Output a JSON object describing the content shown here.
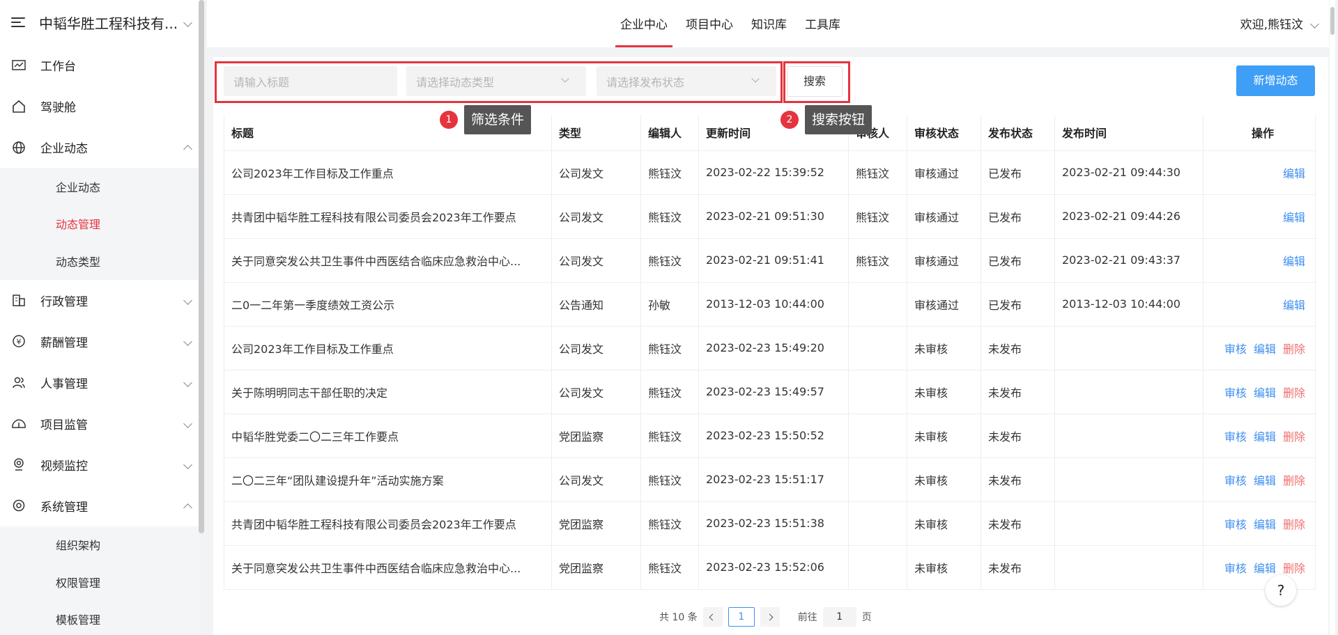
{
  "sidebar": {
    "brand": "中韬华胜工程科技有...",
    "items": [
      {
        "label": "工作台",
        "icon": "chart-line-icon"
      },
      {
        "label": "驾驶舱",
        "icon": "home-icon"
      },
      {
        "label": "企业动态",
        "icon": "globe-icon",
        "expanded": true
      },
      {
        "label": "行政管理",
        "icon": "building-icon"
      },
      {
        "label": "薪酬管理",
        "icon": "money-icon"
      },
      {
        "label": "人事管理",
        "icon": "users-icon"
      },
      {
        "label": "项目监管",
        "icon": "cloud-icon"
      },
      {
        "label": "视频监控",
        "icon": "location-icon"
      },
      {
        "label": "系统管理",
        "icon": "settings-icon",
        "expanded": true
      }
    ],
    "news_sub": [
      "企业动态",
      "动态管理",
      "动态类型"
    ],
    "system_sub": [
      "组织架构",
      "权限管理",
      "模板管理"
    ]
  },
  "topnav": {
    "tabs": [
      "企业中心",
      "项目中心",
      "知识库",
      "工具库"
    ],
    "active_tab": "企业中心",
    "user": "欢迎,熊钰汶"
  },
  "filters": {
    "title_placeholder": "请输入标题",
    "type_placeholder": "请选择动态类型",
    "status_placeholder": "请选择发布状态",
    "search_label": "搜索",
    "add_label": "新增动态"
  },
  "tips": {
    "filter_num": "1",
    "filter_text": "筛选条件",
    "search_num": "2",
    "search_text": "搜索按钮"
  },
  "table": {
    "headers": [
      "标题",
      "类型",
      "编辑人",
      "更新时间",
      "审核人",
      "审核状态",
      "发布状态",
      "发布时间",
      "操作"
    ],
    "rows": [
      {
        "title": "公司2023年工作目标及工作重点",
        "type": "公司发文",
        "editor": "熊钰汶",
        "updated": "2023-02-22 15:39:52",
        "reviewer": "熊钰汶",
        "review": "审核通过",
        "publish": "已发布",
        "published": "2023-02-21 09:44:30",
        "actions": [
          "编辑"
        ]
      },
      {
        "title": "共青团中韬华胜工程科技有限公司委员会2023年工作要点",
        "type": "公司发文",
        "editor": "熊钰汶",
        "updated": "2023-02-21 09:51:30",
        "reviewer": "熊钰汶",
        "review": "审核通过",
        "publish": "已发布",
        "published": "2023-02-21 09:44:26",
        "actions": [
          "编辑"
        ]
      },
      {
        "title": "关于同意突发公共卫生事件中西医结合临床应急救治中心...",
        "type": "公司发文",
        "editor": "熊钰汶",
        "updated": "2023-02-21 09:51:41",
        "reviewer": "熊钰汶",
        "review": "审核通过",
        "publish": "已发布",
        "published": "2023-02-21 09:43:37",
        "actions": [
          "编辑"
        ]
      },
      {
        "title": "二0一二年第一季度绩效工资公示",
        "type": "公告通知",
        "editor": "孙敏",
        "updated": "2013-12-03 10:44:00",
        "reviewer": "",
        "review": "审核通过",
        "publish": "已发布",
        "published": "2013-12-03 10:44:00",
        "actions": [
          "编辑"
        ]
      },
      {
        "title": "公司2023年工作目标及工作重点",
        "type": "公司发文",
        "editor": "熊钰汶",
        "updated": "2023-02-23 15:49:20",
        "reviewer": "",
        "review": "未审核",
        "publish": "未发布",
        "published": "",
        "actions": [
          "审核",
          "编辑",
          "删除"
        ]
      },
      {
        "title": "关于陈明明同志干部任职的决定",
        "type": "公司发文",
        "editor": "熊钰汶",
        "updated": "2023-02-23 15:49:57",
        "reviewer": "",
        "review": "未审核",
        "publish": "未发布",
        "published": "",
        "actions": [
          "审核",
          "编辑",
          "删除"
        ]
      },
      {
        "title": "中韬华胜党委二〇二三年工作要点",
        "type": "党团监察",
        "editor": "熊钰汶",
        "updated": "2023-02-23 15:50:52",
        "reviewer": "",
        "review": "未审核",
        "publish": "未发布",
        "published": "",
        "actions": [
          "审核",
          "编辑",
          "删除"
        ]
      },
      {
        "title": "二〇二三年“团队建设提升年”活动实施方案",
        "type": "公司发文",
        "editor": "熊钰汶",
        "updated": "2023-02-23 15:51:17",
        "reviewer": "",
        "review": "未审核",
        "publish": "未发布",
        "published": "",
        "actions": [
          "审核",
          "编辑",
          "删除"
        ]
      },
      {
        "title": "共青团中韬华胜工程科技有限公司委员会2023年工作要点",
        "type": "党团监察",
        "editor": "熊钰汶",
        "updated": "2023-02-23 15:51:38",
        "reviewer": "",
        "review": "未审核",
        "publish": "未发布",
        "published": "",
        "actions": [
          "审核",
          "编辑",
          "删除"
        ]
      },
      {
        "title": "关于同意突发公共卫生事件中西医结合临床应急救治中心...",
        "type": "党团监察",
        "editor": "熊钰汶",
        "updated": "2023-02-23 15:52:06",
        "reviewer": "",
        "review": "未审核",
        "publish": "未发布",
        "published": "",
        "actions": [
          "审核",
          "编辑",
          "删除"
        ]
      }
    ]
  },
  "pagination": {
    "total": "共 10 条",
    "current": "1",
    "goto_prefix": "前往",
    "goto_value": "1",
    "goto_suffix": "页"
  },
  "help": "?",
  "colors": {
    "accent_red": "#e5343d",
    "primary_blue": "#3f9ef6",
    "link_blue": "#3f8ff0",
    "danger": "#f07070"
  }
}
